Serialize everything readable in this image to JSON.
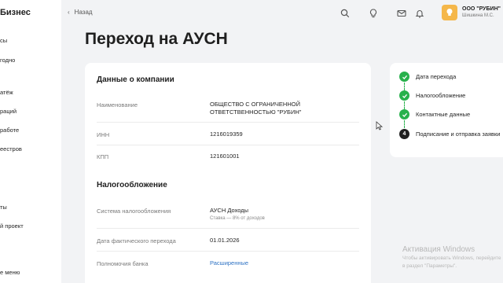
{
  "sidebar": {
    "brand": "Бизнес",
    "items": [
      {
        "label": "сы"
      },
      {
        "label": "годно"
      },
      {
        "label": "атёж"
      },
      {
        "label": "раций"
      },
      {
        "label": "работе"
      },
      {
        "label": "еестров"
      },
      {
        "label": "ты"
      },
      {
        "label": "й проект"
      },
      {
        "label": "е меню"
      }
    ]
  },
  "topbar": {
    "back_label": "Назад",
    "icons": [
      "search-icon",
      "lightbulb-icon",
      "mail-icon",
      "bell-icon"
    ],
    "company": "ООО \"РУБИН\"",
    "person": "Шишкина М.С."
  },
  "page": {
    "title": "Переход на АУСН"
  },
  "company_section": {
    "title": "Данные о компании",
    "rows": [
      {
        "label": "Наименование",
        "value": "ОБЩЕСТВО С ОГРАНИЧЕННОЙ ОТВЕТСТВЕННОСТЬЮ \"РУБИН\""
      },
      {
        "label": "ИНН",
        "value": "1216019359"
      },
      {
        "label": "КПП",
        "value": "121601001"
      }
    ]
  },
  "tax_section": {
    "title": "Налогообложение",
    "rows": [
      {
        "label": "Система налогообложения",
        "value": "АУСН Доходы",
        "sub": "Ставка — 8% от доходов"
      },
      {
        "label": "Дата фактического перехода",
        "value": "01.01.2026"
      },
      {
        "label": "Полномочия банка",
        "value": "Расширенные"
      }
    ]
  },
  "steps": [
    {
      "label": "Дата перехода",
      "status": "done"
    },
    {
      "label": "Налогообложение",
      "status": "done"
    },
    {
      "label": "Контактные данные",
      "status": "done"
    },
    {
      "label": "Подписание и отправка заявки",
      "status": "current",
      "number": "4"
    }
  ],
  "watermark": {
    "title": "Активация Windows",
    "text": "Чтобы активировать Windows, перейдите в раздел \"Параметры\"."
  },
  "colors": {
    "accent_link": "#2f73c4",
    "step_done": "#28b14c",
    "avatar": "#f5b74a"
  }
}
